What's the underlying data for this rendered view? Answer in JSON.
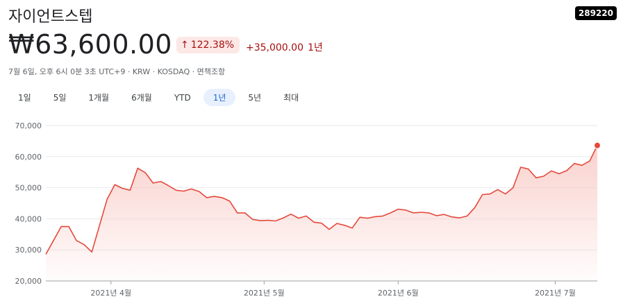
{
  "header": {
    "name": "자이언트스텝",
    "ticker": "289220",
    "price": "₩63,600.00",
    "percent_change": "122.38%",
    "abs_change": "+35,000.00",
    "period_label": "1년",
    "meta": "7월 6일, 오후 6시 0분 3초 UTC+9 · KRW · KOSDAQ · 면책조항"
  },
  "tabs": [
    {
      "label": "1일"
    },
    {
      "label": "5일"
    },
    {
      "label": "1개월"
    },
    {
      "label": "6개월"
    },
    {
      "label": "YTD"
    },
    {
      "label": "1년"
    },
    {
      "label": "5년"
    },
    {
      "label": "최대"
    }
  ],
  "active_tab": 5,
  "colors": {
    "line": "#e5483b",
    "fill_top": "#f8c9c4",
    "marker": "#e5483b"
  },
  "chart_data": {
    "type": "area",
    "ylim": [
      20000,
      70000
    ],
    "yticks": [
      20000,
      30000,
      40000,
      50000,
      60000,
      70000
    ],
    "ytick_labels": [
      "20,000",
      "30,000",
      "40,000",
      "50,000",
      "60,000",
      "70,000"
    ],
    "x_ticks": [
      {
        "label": "2021년 4월",
        "x": 8.5
      },
      {
        "label": "2021년 5월",
        "x": 28.5
      },
      {
        "label": "2021년 6월",
        "x": 46
      },
      {
        "label": "2021년 7월",
        "x": 66.5
      }
    ],
    "x": [
      0,
      1,
      2,
      3,
      4,
      5,
      6,
      7,
      8,
      9,
      10,
      11,
      12,
      13,
      14,
      15,
      16,
      17,
      18,
      19,
      20,
      21,
      22,
      23,
      24,
      25,
      26,
      27,
      28,
      29,
      30,
      31,
      32,
      33,
      34,
      35,
      36,
      37,
      38,
      39,
      40,
      41,
      42,
      43,
      44,
      45,
      46,
      47,
      48,
      49,
      50,
      51,
      52,
      53,
      54,
      55,
      56,
      57,
      58,
      59,
      60,
      61,
      62,
      63,
      64,
      65,
      66,
      67,
      68,
      69
    ],
    "values": [
      28600,
      33000,
      37500,
      37500,
      33000,
      31700,
      29300,
      37800,
      46300,
      51000,
      49800,
      49200,
      56300,
      54800,
      51500,
      52000,
      50700,
      49200,
      48900,
      49600,
      48800,
      46800,
      47200,
      46800,
      45700,
      41900,
      41900,
      39800,
      39400,
      39500,
      39300,
      40300,
      41500,
      40200,
      40900,
      38900,
      38600,
      36600,
      38500,
      37900,
      37000,
      40500,
      40200,
      40700,
      40900,
      41900,
      43100,
      42800,
      41900,
      42100,
      41900,
      41000,
      41400,
      40600,
      40300,
      40900,
      43600,
      47800,
      48000,
      49400,
      48000,
      50000,
      56600,
      56000,
      53200,
      53700,
      55400,
      54500,
      55500,
      57800,
      57200,
      58600,
      63600
    ]
  }
}
